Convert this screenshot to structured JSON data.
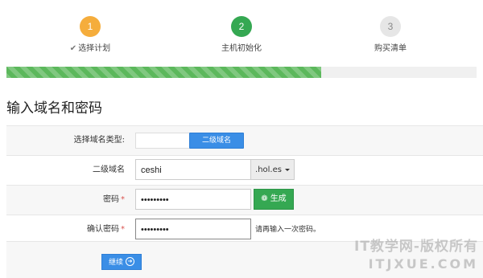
{
  "steps": [
    {
      "number": "1",
      "label": "选择计划",
      "state": "completed"
    },
    {
      "number": "2",
      "label": "主机初始化",
      "state": "active"
    },
    {
      "number": "3",
      "label": "购买清单",
      "state": "pending"
    }
  ],
  "progress": {
    "fraction": 0.67,
    "color": "#5cb85c"
  },
  "heading": "输入域名和密码",
  "form": {
    "domain_type": {
      "label": "选择域名类型:",
      "selected_option": "二级域名"
    },
    "subdomain": {
      "label": "二级域名",
      "value": "ceshi",
      "suffix": ".hol.es"
    },
    "password": {
      "label": "密码",
      "required_mark": "*",
      "value": "•••••••••",
      "generate_label": "生成"
    },
    "confirm_password": {
      "label": "确认密码",
      "required_mark": "*",
      "value": "•••••••••",
      "hint": "请再输入一次密码。"
    }
  },
  "continue_label": "继续",
  "watermark": {
    "line1": "IT教学网-版权所有",
    "line2": "ITJXUE.COM"
  },
  "colors": {
    "step1": "#f5ad3c",
    "step2": "#35a852",
    "step3": "#e6e6e6",
    "primary": "#3a8ee6",
    "success": "#35a852",
    "required": "#d9534f"
  },
  "icons": {
    "step1_check": "check-icon",
    "generate": "gear-icon",
    "continue": "arrow-right-circle-icon",
    "suffix_dropdown": "caret-down-icon"
  }
}
